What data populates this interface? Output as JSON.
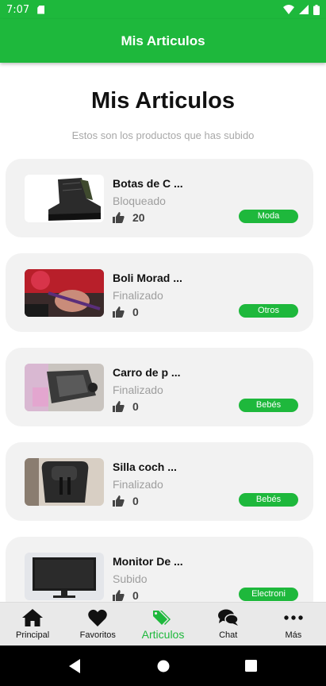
{
  "status_bar": {
    "time": "7:07"
  },
  "app_bar": {
    "title": "Mis Articulos"
  },
  "page": {
    "heading": "Mis Articulos",
    "subtitle": "Estos son los productos que has subido"
  },
  "items": [
    {
      "title": "Botas de C ...",
      "status": "Bloqueado",
      "likes": "20",
      "category": "Moda"
    },
    {
      "title": "Boli Morad ...",
      "status": "Finalizado",
      "likes": "0",
      "category": "Otros"
    },
    {
      "title": "Carro de p ...",
      "status": "Finalizado",
      "likes": "0",
      "category": "Bebés"
    },
    {
      "title": "Silla coch ...",
      "status": "Finalizado",
      "likes": "0",
      "category": "Bebés"
    },
    {
      "title": "Monitor De ...",
      "status": "Subido",
      "likes": "0",
      "category": "Electroni"
    }
  ],
  "bottom_nav": [
    {
      "label": "Principal",
      "icon": "home-icon"
    },
    {
      "label": "Favoritos",
      "icon": "heart-icon"
    },
    {
      "label": "Articulos",
      "icon": "tag-icon",
      "active": true
    },
    {
      "label": "Chat",
      "icon": "chat-icon"
    },
    {
      "label": "Más",
      "icon": "more-icon"
    }
  ],
  "colors": {
    "accent": "#1eb83c",
    "card_bg": "#f2f2f2",
    "nav_bg": "#e9e9e9"
  }
}
